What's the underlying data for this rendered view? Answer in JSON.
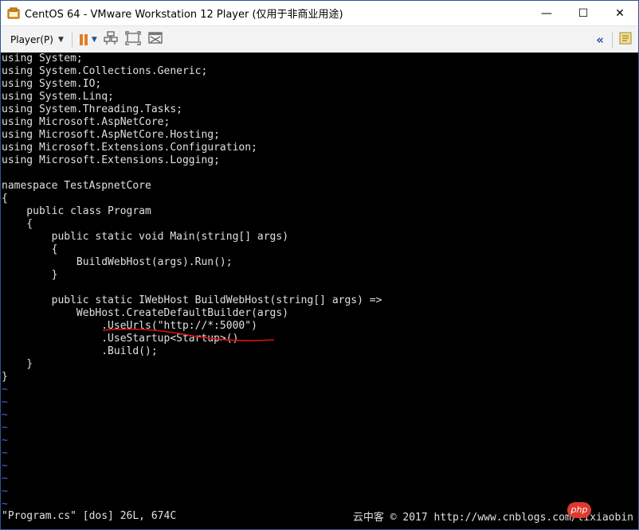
{
  "window": {
    "title": "CentOS 64 - VMware Workstation 12 Player (仅用于非商业用途)",
    "minimize_glyph": "—",
    "maximize_glyph": "☐",
    "close_glyph": "✕"
  },
  "toolbar": {
    "player_menu_label": "Player(P)",
    "player_menu_caret": "▼",
    "pause_caret": "▼",
    "collapse_glyph": "«",
    "icons": [
      "pause-icon",
      "send-ctrl-alt-del-icon",
      "fullscreen-icon",
      "unity-icon",
      "collapse-icon",
      "notes-icon"
    ]
  },
  "editor": {
    "lines": [
      "using System;",
      "using System.Collections.Generic;",
      "using System.IO;",
      "using System.Linq;",
      "using System.Threading.Tasks;",
      "using Microsoft.AspNetCore;",
      "using Microsoft.AspNetCore.Hosting;",
      "using Microsoft.Extensions.Configuration;",
      "using Microsoft.Extensions.Logging;",
      "",
      "namespace TestAspnetCore",
      "{",
      "    public class Program",
      "    {",
      "        public static void Main(string[] args)",
      "        {",
      "            BuildWebHost(args).Run();",
      "        }",
      "",
      "        public static IWebHost BuildWebHost(string[] args) =>",
      "            WebHost.CreateDefaultBuilder(args)",
      "                .UseUrls(\"http://*:5000\")",
      "                .UseStartup<Startup>()",
      "                .Build();",
      "    }",
      "}"
    ],
    "tildes": [
      "~",
      "~",
      "~",
      "~",
      "~",
      "~",
      "~",
      "~",
      "~",
      "~"
    ],
    "status": "\"Program.cs\" [dos] 26L, 674C",
    "watermark": "云中客 © 2017 http://www.cnblogs.com/lixiaobin",
    "badge": "php",
    "colors": {
      "background": "#000000",
      "text": "#e0e0e0",
      "tilde": "#5a5af0",
      "annotation": "#e01010",
      "accent": "#e27c21"
    }
  }
}
